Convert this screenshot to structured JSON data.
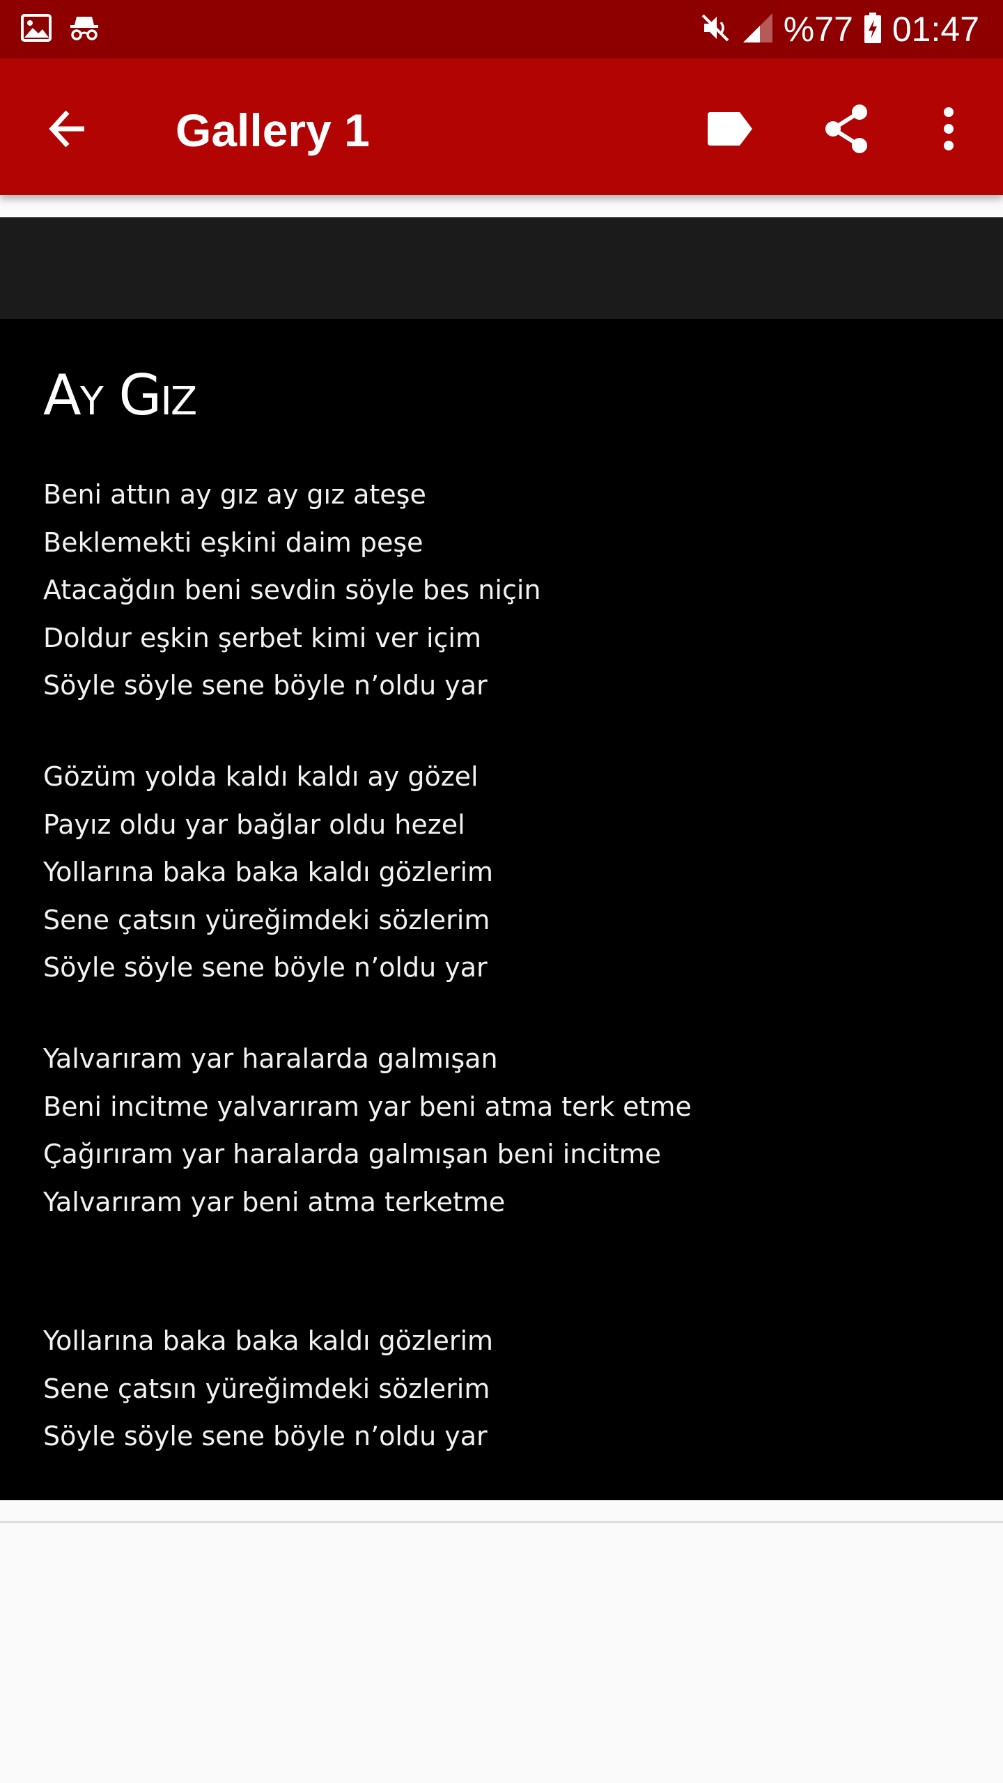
{
  "status_bar": {
    "icons_left": [
      "image-icon",
      "incognito-icon"
    ],
    "icons_right": [
      "mute-icon",
      "signal-icon",
      "battery-charging-icon"
    ],
    "battery": "%77",
    "time": "01:47"
  },
  "app_bar": {
    "title": "Gallery 1",
    "actions": [
      "back-arrow-icon",
      "tag-icon",
      "share-icon",
      "more-vert-icon"
    ]
  },
  "colors": {
    "status_bar": "#8e0000",
    "app_bar": "#b30404",
    "poem_background": "#000000",
    "strip": "#1b1b1c",
    "page_background": "#fafafa"
  },
  "poem": {
    "title": "Ay Gız",
    "stanzas": [
      [
        "Beni attın ay gız ay gız ateşe",
        "Beklemekti eşkini daim peşe",
        "Atacağdın beni sevdin söyle bes niçin",
        "Doldur eşkin şerbet kimi ver içim",
        "Söyle söyle sene böyle n’oldu yar"
      ],
      [
        "Gözüm yolda kaldı kaldı ay gözel",
        "Payız oldu yar bağlar oldu hezel",
        "Yollarına baka baka kaldı gözlerim",
        "Sene çatsın yüreğimdeki sözlerim",
        "Söyle söyle sene böyle n’oldu yar"
      ],
      [
        "Yalvarıram yar haralarda galmışan",
        "Beni incitme yalvarıram yar beni atma terk etme",
        "Çağırıram yar haralarda galmışan beni incitme",
        "Yalvarıram yar beni atma terketme"
      ],
      [
        "Yollarına baka baka kaldı gözlerim",
        "Sene çatsın yüreğimdeki sözlerim",
        "Söyle söyle sene böyle n’oldu yar"
      ]
    ]
  }
}
